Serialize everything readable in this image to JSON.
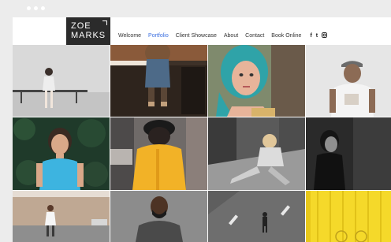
{
  "browser": {
    "window_dots": 3
  },
  "site": {
    "logo_line1": "ZOE",
    "logo_line2": "MARKS",
    "nav": [
      {
        "label": "Welcome",
        "active": false
      },
      {
        "label": "Portfolio",
        "active": true
      },
      {
        "label": "Client Showcase",
        "active": false
      },
      {
        "label": "About",
        "active": false
      },
      {
        "label": "Contact",
        "active": false
      },
      {
        "label": "Book Online",
        "active": false
      }
    ],
    "social_icons": [
      "facebook-icon",
      "twitter-icon",
      "instagram-icon"
    ],
    "social_glyphs": [
      "f",
      "t",
      "ig"
    ]
  },
  "gallery": {
    "photos": [
      "woman-sitting-on-bench",
      "person-in-doorway",
      "woman-with-teal-hair",
      "man-with-cap-smiling",
      "woman-among-leaves",
      "woman-in-yellow-jacket",
      "woman-sitting-on-street",
      "woman-in-dark-shadow",
      "woman-by-brick-wall",
      "man-with-beard",
      "man-walking-on-road",
      "yellow-wall-bicycle"
    ]
  },
  "colors": {
    "accent": "#3b6fe0",
    "logo_bg": "#2b2b2b",
    "chrome": "#ececec"
  }
}
